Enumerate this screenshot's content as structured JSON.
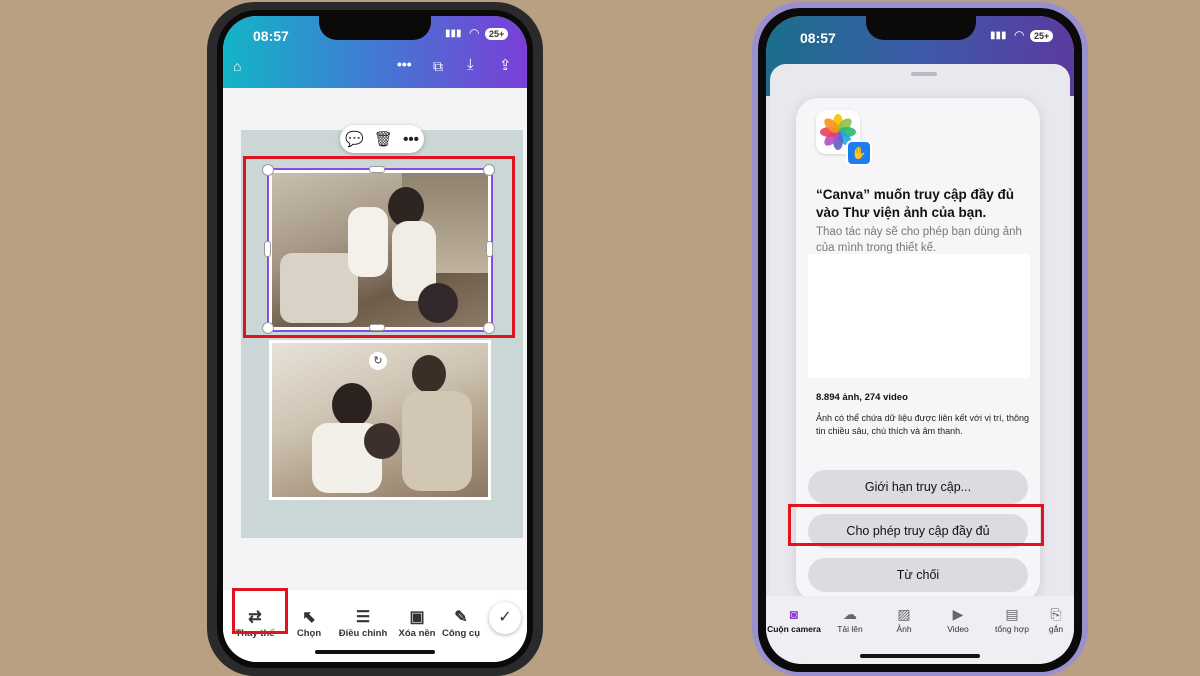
{
  "left_phone": {
    "status": {
      "time": "08:57",
      "battery": "25+"
    },
    "top_icons": [
      "home-icon",
      "more-icon",
      "duplicate-icon",
      "download-icon",
      "share-icon"
    ],
    "mini_toolbar": [
      "comment-icon",
      "trash-icon",
      "more-icon"
    ],
    "bottom_tools": [
      {
        "label": "Thay thế",
        "icon": "replace-icon"
      },
      {
        "label": "Chọn",
        "icon": "select-icon"
      },
      {
        "label": "Điều chỉnh",
        "icon": "adjust-icon"
      },
      {
        "label": "Xóa nền",
        "icon": "bg-remove-icon"
      },
      {
        "label": "Công cụ",
        "icon": "tools-icon"
      }
    ],
    "accent": "#8a4be0",
    "highlight": "#e0141e"
  },
  "right_phone": {
    "status": {
      "time": "08:57",
      "battery": "25+"
    },
    "dialog": {
      "title": "“Canva” muốn truy cập đầy đủ vào Thư viện ảnh của bạn.",
      "subtitle": "Thao tác này sẽ cho phép bạn dùng ảnh của mình trong thiết kế.",
      "count": "8.894 ảnh, 274 video",
      "note": "Ảnh có thể chứa dữ liệu được liên kết với vị trí, thông tin chiều sâu, chú thích và âm thanh.",
      "btn_limit": "Giới hạn truy cập...",
      "btn_allow": "Cho phép truy cập đầy đủ",
      "btn_deny": "Từ chối"
    },
    "bottom_nav": [
      {
        "label": "Cuộn camera",
        "icon": "camera-icon"
      },
      {
        "label": "Tải lên",
        "icon": "upload-icon"
      },
      {
        "label": "Ảnh",
        "icon": "image-icon"
      },
      {
        "label": "Video",
        "icon": "video-icon"
      },
      {
        "label": "tổng hợp",
        "icon": "collection-icon"
      },
      {
        "label": "gắn",
        "icon": "attach-icon"
      }
    ]
  }
}
